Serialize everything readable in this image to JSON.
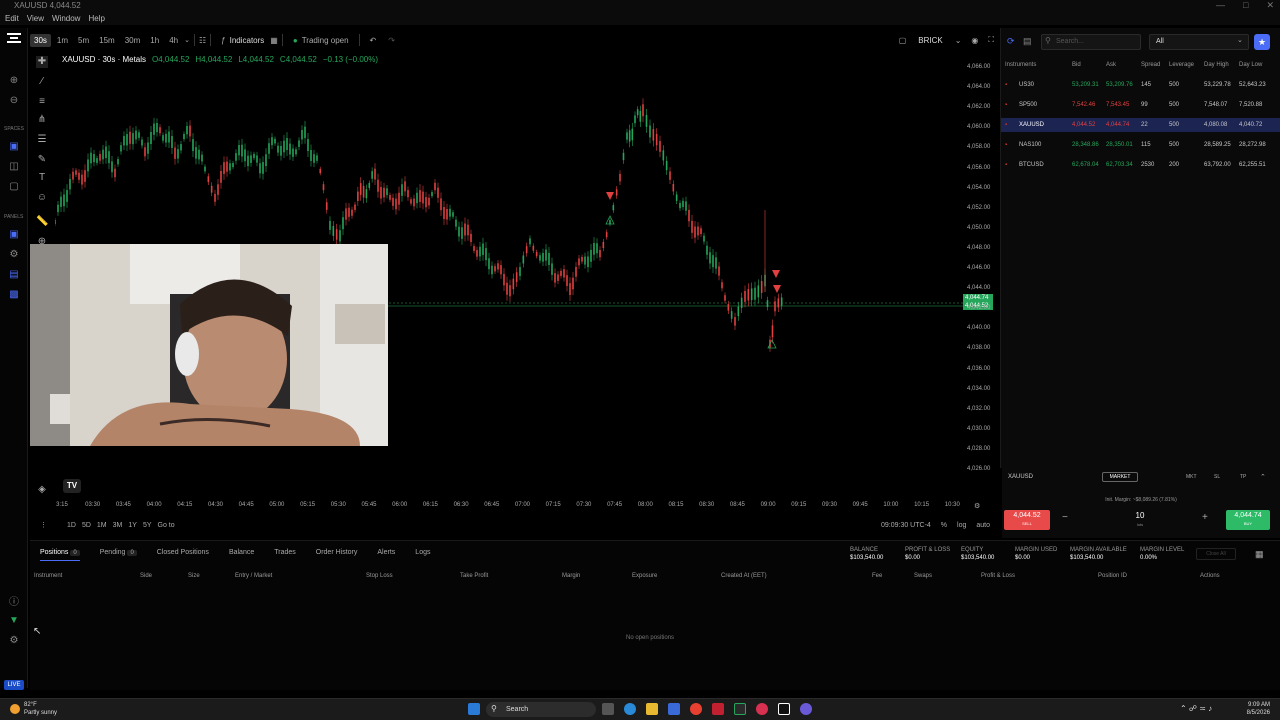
{
  "window": {
    "title": "XAUUSD 4,044.52",
    "menus": [
      "Edit",
      "View",
      "Window",
      "Help"
    ]
  },
  "toolbar": {
    "timeframes": [
      "30s",
      "1m",
      "5m",
      "15m",
      "30m",
      "1h",
      "4h"
    ],
    "active_timeframe": "30s",
    "indicators_label": "Indicators",
    "trading_status": "Trading open",
    "chart_style": "BRICK"
  },
  "legend": {
    "symbol": "XAUUSD · 30s · Metals",
    "open": "O4,044.52",
    "high": "H4,044.52",
    "low": "L4,044.52",
    "close": "C4,044.52",
    "change": "−0.13 (−0.00%)"
  },
  "price_axis": {
    "labels": [
      "4,066.00",
      "4,064.00",
      "4,062.00",
      "4,060.00",
      "4,058.00",
      "4,056.00",
      "4,054.00",
      "4,052.00",
      "4,050.00",
      "4,048.00",
      "4,046.00",
      "4,044.00",
      "4,042.00",
      "4,040.00",
      "4,038.00",
      "4,036.00",
      "4,034.00",
      "4,032.00",
      "4,030.00",
      "4,028.00",
      "4,026.00"
    ],
    "current_bid": "4,044.74",
    "current_ask": "4,044.52"
  },
  "time_axis": [
    "3:15",
    "03:30",
    "03:45",
    "04:00",
    "04:15",
    "04:30",
    "04:45",
    "05:00",
    "05:15",
    "05:30",
    "05:45",
    "06:00",
    "06:15",
    "06:30",
    "06:45",
    "07:00",
    "07:15",
    "07:30",
    "07:45",
    "08:00",
    "08:15",
    "08:30",
    "08:45",
    "09:00",
    "09:15",
    "09:30",
    "09:45",
    "10:00",
    "10:15",
    "10:30"
  ],
  "range_bar": {
    "ranges": [
      "1D",
      "5D",
      "1M",
      "3M",
      "1Y",
      "5Y"
    ],
    "goto": "Go to",
    "time": "09:09:30 UTC-4",
    "percent": "%",
    "log": "log",
    "auto": "auto"
  },
  "watchlist": {
    "search_placeholder": "Search...",
    "filter": "All",
    "headers": [
      "Instruments",
      "Bid",
      "Ask",
      "Spread",
      "Leverage",
      "Day High",
      "Day Low"
    ],
    "rows": [
      {
        "symbol": "US30",
        "bid": "53,209.31",
        "ask": "53,209.76",
        "spread": "145",
        "leverage": "500",
        "high": "53,229.78",
        "low": "52,643.23",
        "dir": "up",
        "selected": false
      },
      {
        "symbol": "SP500",
        "bid": "7,542.46",
        "ask": "7,543.45",
        "spread": "99",
        "leverage": "500",
        "high": "7,548.07",
        "low": "7,520.88",
        "dir": "down",
        "selected": false
      },
      {
        "symbol": "XAUUSD",
        "bid": "4,044.52",
        "ask": "4,044.74",
        "spread": "22",
        "leverage": "500",
        "high": "4,080.08",
        "low": "4,040.72",
        "dir": "down",
        "selected": true
      },
      {
        "symbol": "NAS100",
        "bid": "28,348.86",
        "ask": "28,350.01",
        "spread": "115",
        "leverage": "500",
        "high": "28,589.25",
        "low": "28,272.98",
        "dir": "up",
        "selected": false
      },
      {
        "symbol": "BTCUSD",
        "bid": "62,678.04",
        "ask": "62,703.34",
        "spread": "2530",
        "leverage": "200",
        "high": "63,792.00",
        "low": "62,255.51",
        "dir": "up",
        "selected": false
      }
    ]
  },
  "order_panel": {
    "symbol": "XAUUSD",
    "order_type": "MARKET",
    "tabs": [
      "MKT",
      "SL",
      "TP"
    ],
    "margin_text": "Init. Margin: ~$8,089.26 (7.81%)",
    "sell_price": "4,044.52",
    "sell_label": "SELL",
    "buy_price": "4,044.74",
    "buy_label": "BUY",
    "lots": "10",
    "lots_label": "lots"
  },
  "bottom": {
    "tabs": [
      {
        "label": "Positions",
        "count": "0"
      },
      {
        "label": "Pending",
        "count": "0"
      },
      {
        "label": "Closed Positions",
        "count": ""
      },
      {
        "label": "Balance",
        "count": ""
      },
      {
        "label": "Trades",
        "count": ""
      },
      {
        "label": "Order History",
        "count": ""
      },
      {
        "label": "Alerts",
        "count": ""
      },
      {
        "label": "Logs",
        "count": ""
      }
    ],
    "stats": [
      {
        "label": "BALANCE",
        "value": "$103,540.00"
      },
      {
        "label": "PROFIT & LOSS",
        "value": "$0.00"
      },
      {
        "label": "EQUITY",
        "value": "$103,540.00"
      },
      {
        "label": "MARGIN USED",
        "value": "$0.00"
      },
      {
        "label": "MARGIN AVAILABLE",
        "value": "$103,540.00"
      },
      {
        "label": "MARGIN LEVEL",
        "value": "0.00%"
      }
    ],
    "close_all": "Close All",
    "columns": [
      "Instrument",
      "Side",
      "Size",
      "Entry / Market",
      "Stop Loss",
      "Take Profit",
      "Margin",
      "Exposure",
      "Created At (EET)",
      "Fee",
      "Swaps",
      "Profit & Loss",
      "Position ID",
      "Actions"
    ],
    "empty_text": "No open positions"
  },
  "sidebar": {
    "spaces_label": "SPACES",
    "panels_label": "PANELS",
    "live_label": "LIVE"
  },
  "taskbar": {
    "temp": "82°F",
    "weather": "Partly sunny",
    "search": "Search",
    "time": "9:09 AM",
    "date": "8/5/2026"
  },
  "colors": {
    "up": "#26a65b",
    "down": "#e04040",
    "accent": "#4a6cf7"
  }
}
